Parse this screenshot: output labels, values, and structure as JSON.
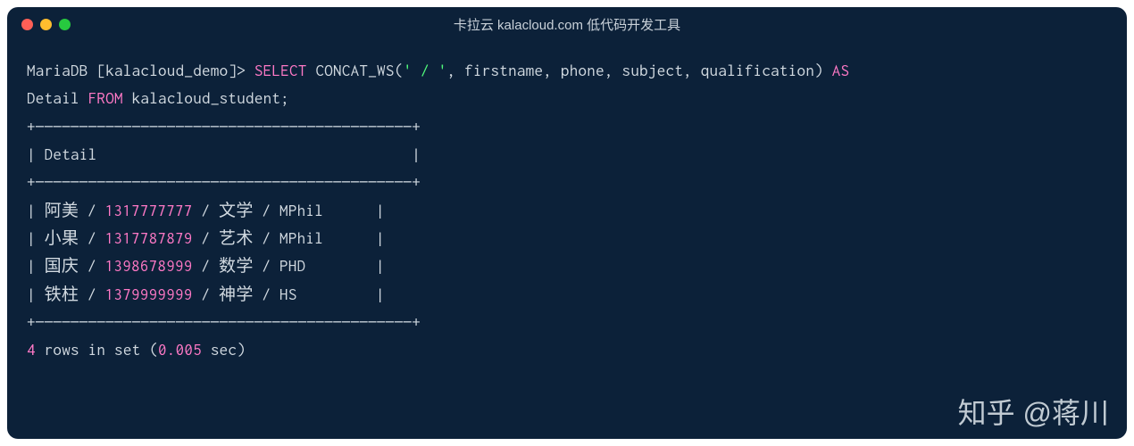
{
  "window": {
    "title": "卡拉云 kalacloud.com 低代码开发工具"
  },
  "prompt": {
    "prefix": "MariaDB [kalacloud_demo]> "
  },
  "sql": {
    "select": "SELECT",
    "func": "CONCAT_WS",
    "lparen": "(",
    "sep_string": "' / '",
    "comma1": ", ",
    "arg1": "firstname",
    "comma2": ", ",
    "arg2": "phone",
    "comma3": ", ",
    "arg3": "subject",
    "comma4": ", ",
    "arg4": "qualification",
    "rparen": ")",
    "as": " AS",
    "alias": "Detail",
    "from": " FROM",
    "table": " kalacloud_student;"
  },
  "result": {
    "border_top": "+———————————————————————————————————————————+",
    "header_line": "| Detail                                    |",
    "border_mid": "+———————————————————————————————————————————+",
    "rows": [
      {
        "p1": "| 阿美 / ",
        "num": "1317777777",
        "p2": " / 文学 / MPhil      |"
      },
      {
        "p1": "| 小果 / ",
        "num": "1317787879",
        "p2": " / 艺术 / MPhil      |"
      },
      {
        "p1": "| 国庆 / ",
        "num": "1398678999",
        "p2": " / 数学 / PHD        |"
      },
      {
        "p1": "| 铁柱 / ",
        "num": "1379999999",
        "p2": " / 神学 / HS         |"
      }
    ],
    "border_bottom": "+———————————————————————————————————————————+",
    "summary_num": "4",
    "summary_mid": " rows in set (",
    "summary_time": "0.005",
    "summary_end": " sec)"
  },
  "watermark": "知乎 @蒋川"
}
